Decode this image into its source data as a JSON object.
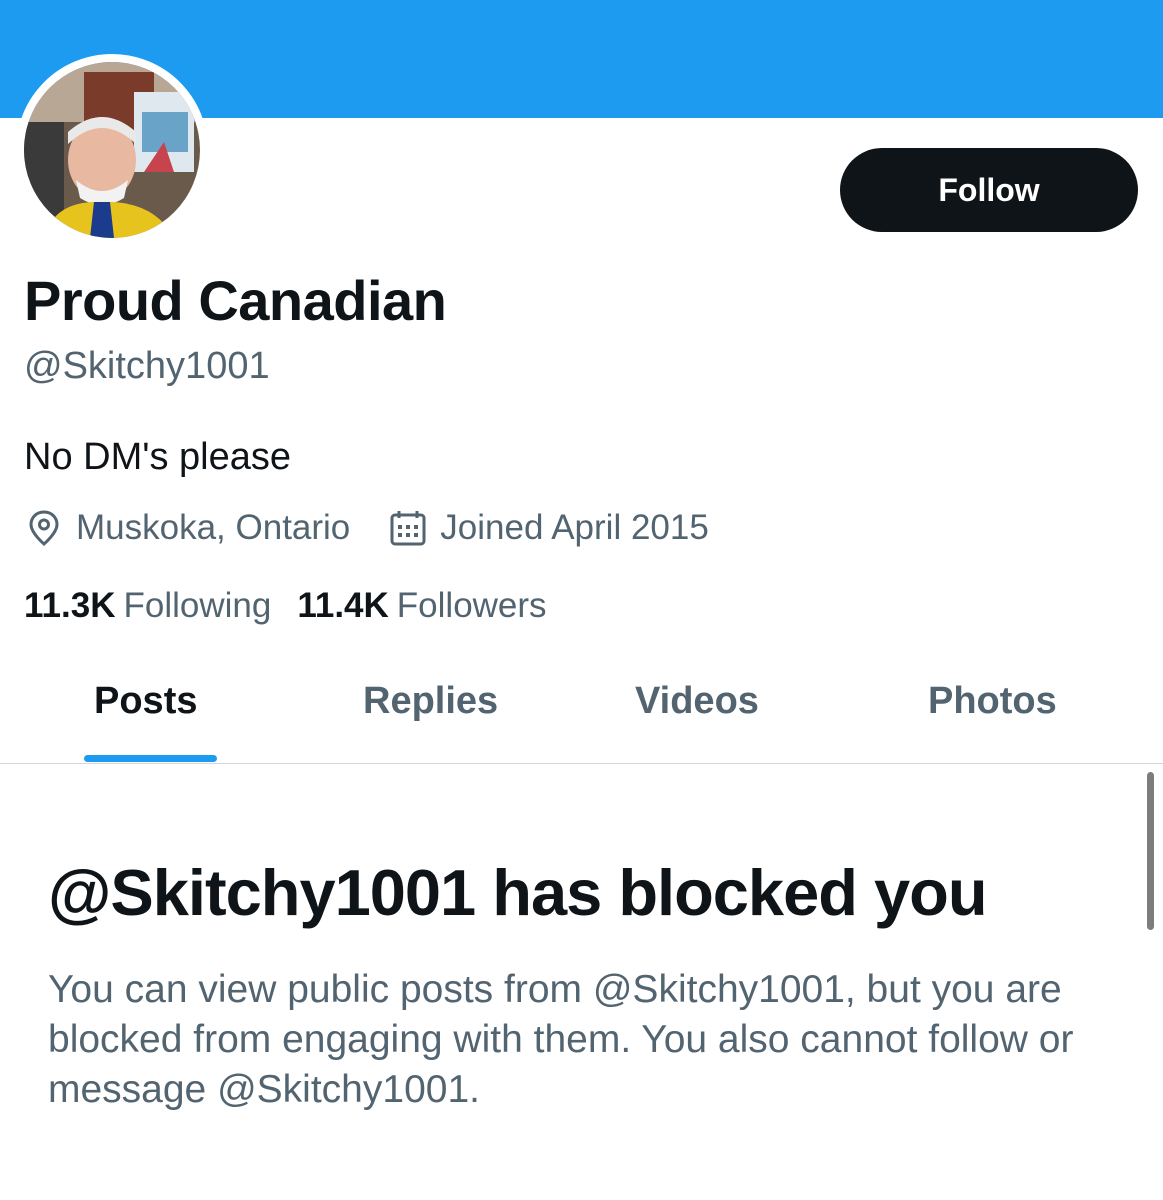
{
  "profile": {
    "display_name": "Proud Canadian",
    "handle": "@Skitchy1001",
    "bio": "No DM's please",
    "location": "Muskoka, Ontario",
    "joined": "Joined April 2015",
    "following_count": "11.3K",
    "following_label": "Following",
    "followers_count": "11.4K",
    "followers_label": "Followers"
  },
  "actions": {
    "follow_label": "Follow"
  },
  "tabs": [
    {
      "label": "Posts",
      "active": true
    },
    {
      "label": "Replies",
      "active": false
    },
    {
      "label": "Videos",
      "active": false
    },
    {
      "label": "Photos",
      "active": false
    }
  ],
  "blocked": {
    "title": "@Skitchy1001 has blocked you",
    "description": "You can view public posts from @Skitchy1001, but you are blocked from engaging with them. You also cannot follow or message @Skitchy1001."
  },
  "icons": {
    "location": "location-pin-icon",
    "joined": "calendar-icon"
  },
  "colors": {
    "accent": "#1d9bf0",
    "primary_text": "#0f1419",
    "secondary_text": "#536471",
    "follow_button_bg": "#0f1419"
  }
}
